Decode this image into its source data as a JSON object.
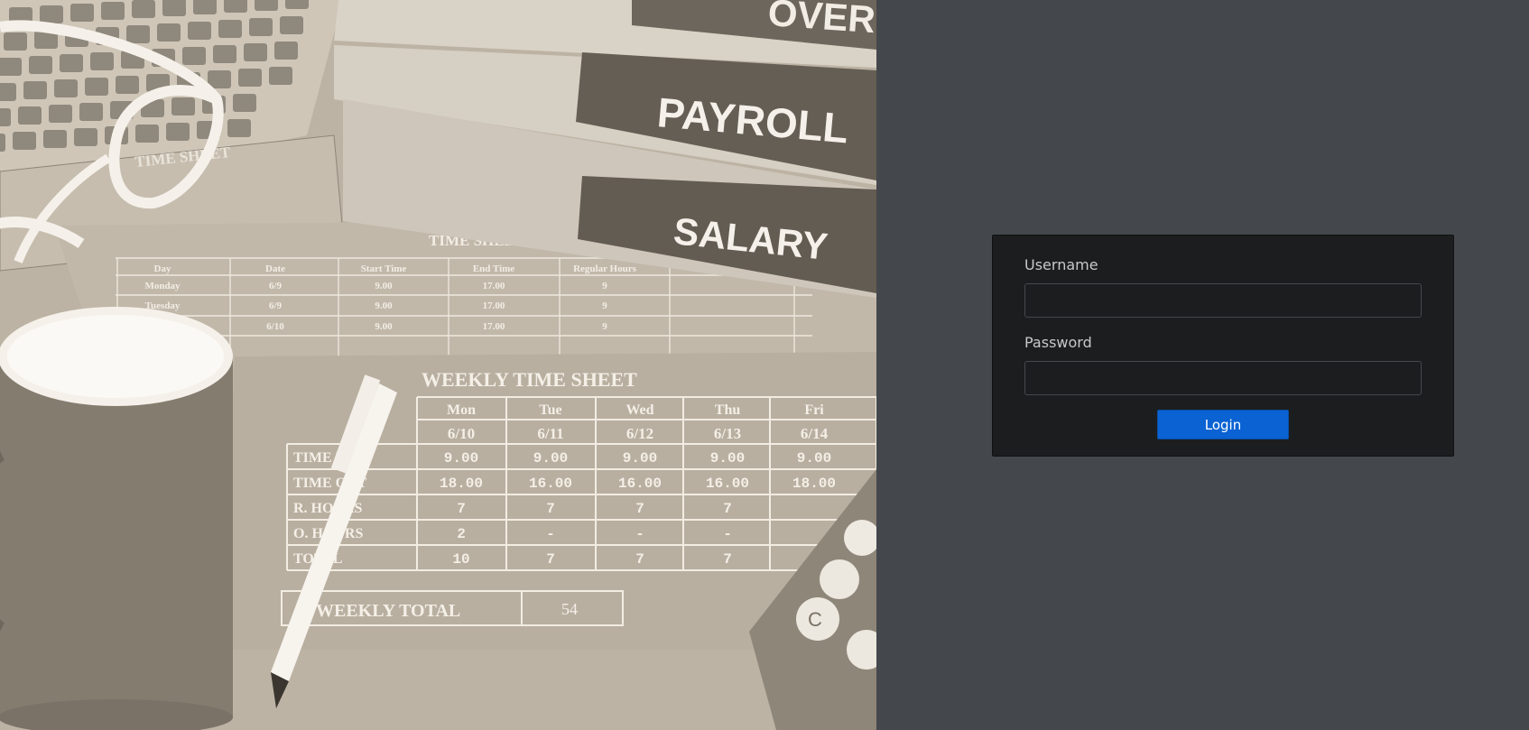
{
  "hero_image": {
    "binder_labels": [
      "OVER TIME",
      "PAYROLL",
      "SALARY"
    ],
    "timesheet_top_title": "TIME SHEET",
    "timesheet_mid_title": "TIME SHEET",
    "timesheet_mid_headers": [
      "Day",
      "Date",
      "Start Time",
      "End Time",
      "Regular Hours"
    ],
    "timesheet_mid_rows": [
      [
        "Monday",
        "6/9",
        "9.00",
        "17.00",
        "9"
      ],
      [
        "Tuesday",
        "6/9",
        "9.00",
        "17.00",
        "9"
      ],
      [
        "",
        "6/10",
        "9.00",
        "17.00",
        "9"
      ]
    ],
    "weekly_title": "WEEKLY TIME SHEET",
    "weekly_days": [
      "Mon",
      "Tue",
      "Wed",
      "Thu",
      "Fri"
    ],
    "weekly_dates": [
      "6/10",
      "6/11",
      "6/12",
      "6/13",
      "6/14"
    ],
    "weekly_row_labels": [
      "TIME IN",
      "TIME OUT",
      "R. HOURS",
      "O. HOURS",
      "TOTAL"
    ],
    "weekly_rows": [
      [
        "9.00",
        "9.00",
        "9.00",
        "9.00",
        "9.00"
      ],
      [
        "18.00",
        "16.00",
        "16.00",
        "16.00",
        "18.00"
      ],
      [
        "7",
        "7",
        "7",
        "7",
        ""
      ],
      [
        "2",
        "-",
        "-",
        "-",
        ""
      ],
      [
        "10",
        "7",
        "7",
        "7",
        ""
      ]
    ],
    "weekly_total_label": "WEEKLY TOTAL",
    "weekly_total_value": "54",
    "calculator_key": "C"
  },
  "login": {
    "username_label": "Username",
    "username_value": "",
    "password_label": "Password",
    "password_value": "",
    "login_button": "Login"
  },
  "colors": {
    "background": "#44484d",
    "card": "#1c1d1f",
    "button": "#0a62d3"
  }
}
